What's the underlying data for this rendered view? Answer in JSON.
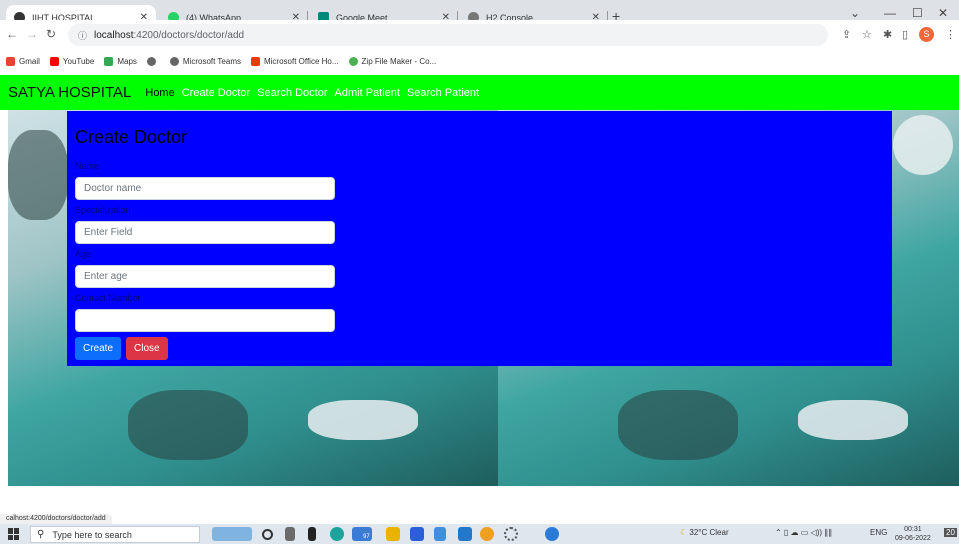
{
  "browser": {
    "tabs": [
      {
        "label": "IIHT HOSPITAL",
        "active": true
      },
      {
        "label": "(4) WhatsApp",
        "active": false
      },
      {
        "label": "Google Meet",
        "active": false
      },
      {
        "label": "H2 Console",
        "active": false
      }
    ],
    "url_host": "localhost",
    "url_path": ":4200/doctors/doctor/add",
    "profile_initial": "S",
    "bookmarks": [
      "Gmail",
      "YouTube",
      "Maps",
      "",
      "Microsoft Teams",
      "Microsoft Office Ho...",
      "Zip File Maker - Co..."
    ]
  },
  "app": {
    "brand": "SATYA  HOSPITAL",
    "nav": [
      "Home",
      "Create Doctor",
      "Search Doctor",
      "Admit Patient",
      "Search Patient"
    ]
  },
  "form": {
    "title": "Create Doctor",
    "fields": [
      {
        "label": "Name",
        "placeholder": "Doctor name",
        "value": ""
      },
      {
        "label": "Specialization",
        "placeholder": "Enter Field",
        "value": ""
      },
      {
        "label": "Age",
        "placeholder": "Enter age",
        "value": ""
      },
      {
        "label": "Contact Number",
        "placeholder": "",
        "value": ""
      }
    ],
    "create_label": "Create",
    "close_label": "Close"
  },
  "status_url": "calhost:4200/doctors/doctor/add",
  "taskbar": {
    "search_placeholder": "Type here to search",
    "badge": "97",
    "weather": "32°C  Clear",
    "lang": "ENG",
    "time": "00:31",
    "date": "09-06-2022",
    "notif": "20"
  },
  "colors": {
    "navbar": "#00ff00",
    "form_bg": "#0000ff",
    "create_btn": "#0d6efd",
    "close_btn": "#dc3545"
  }
}
